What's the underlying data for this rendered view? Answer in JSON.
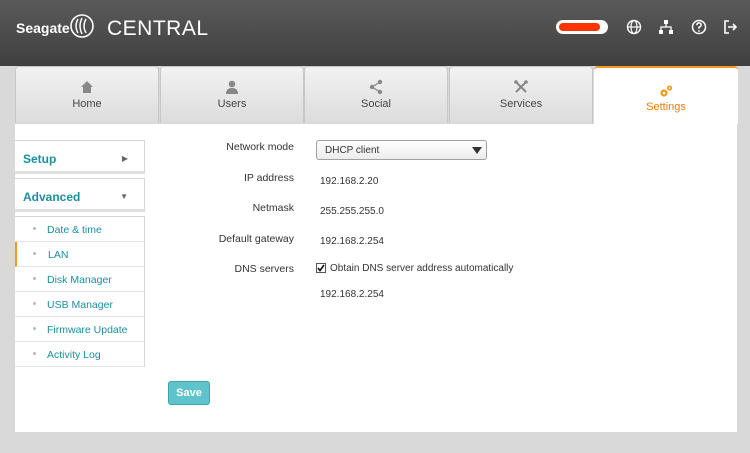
{
  "header": {
    "brand": "Seagate",
    "product": "CENTRAL",
    "status_fill": 0.9,
    "icons": [
      "globe-icon",
      "network-icon",
      "help-icon",
      "logout-icon"
    ]
  },
  "tabs": [
    {
      "label": "Home",
      "icon": "house-icon"
    },
    {
      "label": "Users",
      "icon": "user-icon"
    },
    {
      "label": "Social",
      "icon": "share-icon"
    },
    {
      "label": "Services",
      "icon": "tools-icon"
    },
    {
      "label": "Settings",
      "icon": "gears-icon",
      "active": true
    }
  ],
  "sidebar": {
    "setup_label": "Setup",
    "advanced_label": "Advanced",
    "items": [
      {
        "label": "Date & time"
      },
      {
        "label": "LAN",
        "active": true
      },
      {
        "label": "Disk Manager"
      },
      {
        "label": "USB Manager"
      },
      {
        "label": "Firmware Update"
      },
      {
        "label": "Activity Log"
      }
    ]
  },
  "form": {
    "network_mode_label": "Network mode",
    "network_mode_value": "DHCP client",
    "ip_label": "IP address",
    "ip_value": "192.168.2.20",
    "netmask_label": "Netmask",
    "netmask_value": "255.255.255.0",
    "gateway_label": "Default gateway",
    "gateway_value": "192.168.2.254",
    "dns_label": "DNS servers",
    "dns_auto_label": "Obtain DNS server address automatically",
    "dns_auto_checked": true,
    "dns_value": "192.168.2.254",
    "save_label": "Save"
  },
  "colors": {
    "accent": "#f39b1f",
    "link": "#1a8fa0",
    "button": "#5fc3cc",
    "status": "#ff3300"
  }
}
